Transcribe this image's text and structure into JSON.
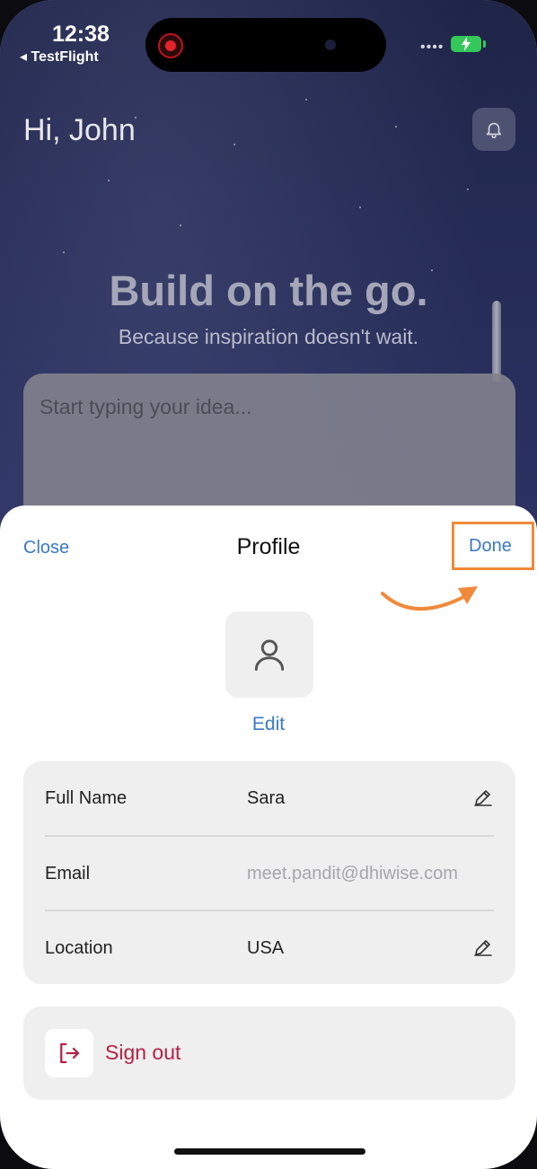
{
  "status_bar": {
    "time": "12:38",
    "back_app": "◂ TestFlight",
    "signal": "••••",
    "battery_color": "#34c759"
  },
  "home": {
    "greeting": "Hi, John",
    "headline": "Build on the go.",
    "subline": "Because inspiration doesn't wait.",
    "idea_placeholder": "Start typing your idea..."
  },
  "sheet": {
    "close_label": "Close",
    "title": "Profile",
    "done_label": "Done",
    "edit_avatar_label": "Edit",
    "fields": [
      {
        "label": "Full Name",
        "value": "Sara",
        "editable": true
      },
      {
        "label": "Email",
        "value": "meet.pandit@dhiwise.com",
        "editable": false
      },
      {
        "label": "Location",
        "value": "USA",
        "editable": true
      }
    ],
    "sign_out_label": "Sign out"
  },
  "colors": {
    "accent_blue": "#3a78c4",
    "sign_out_red": "#b32144",
    "highlight_orange": "#f08a3a"
  }
}
